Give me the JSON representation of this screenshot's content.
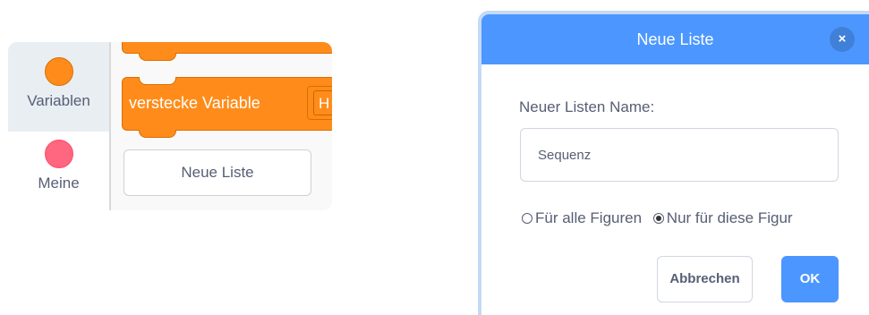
{
  "palette": {
    "categories": [
      {
        "label": "Variablen",
        "color": "#ff8c1a",
        "selected": true
      },
      {
        "label": "Meine",
        "color": "#ff6680",
        "selected": false
      }
    ],
    "blocks": {
      "hide_variable_text": "verstecke Variable",
      "dropdown_text": "H",
      "block_color": "#ff8c1a"
    },
    "new_list_button": "Neue Liste"
  },
  "modal": {
    "title": "Neue Liste",
    "header_color": "#4c97ff",
    "close_icon": "×",
    "field_label": "Neuer Listen Name:",
    "name_value": "Sequenz",
    "options": [
      {
        "label": "Für alle Figuren",
        "selected": false
      },
      {
        "label": "Nur für diese Figur",
        "selected": true
      }
    ],
    "cancel_label": "Abbrechen",
    "ok_label": "OK"
  }
}
